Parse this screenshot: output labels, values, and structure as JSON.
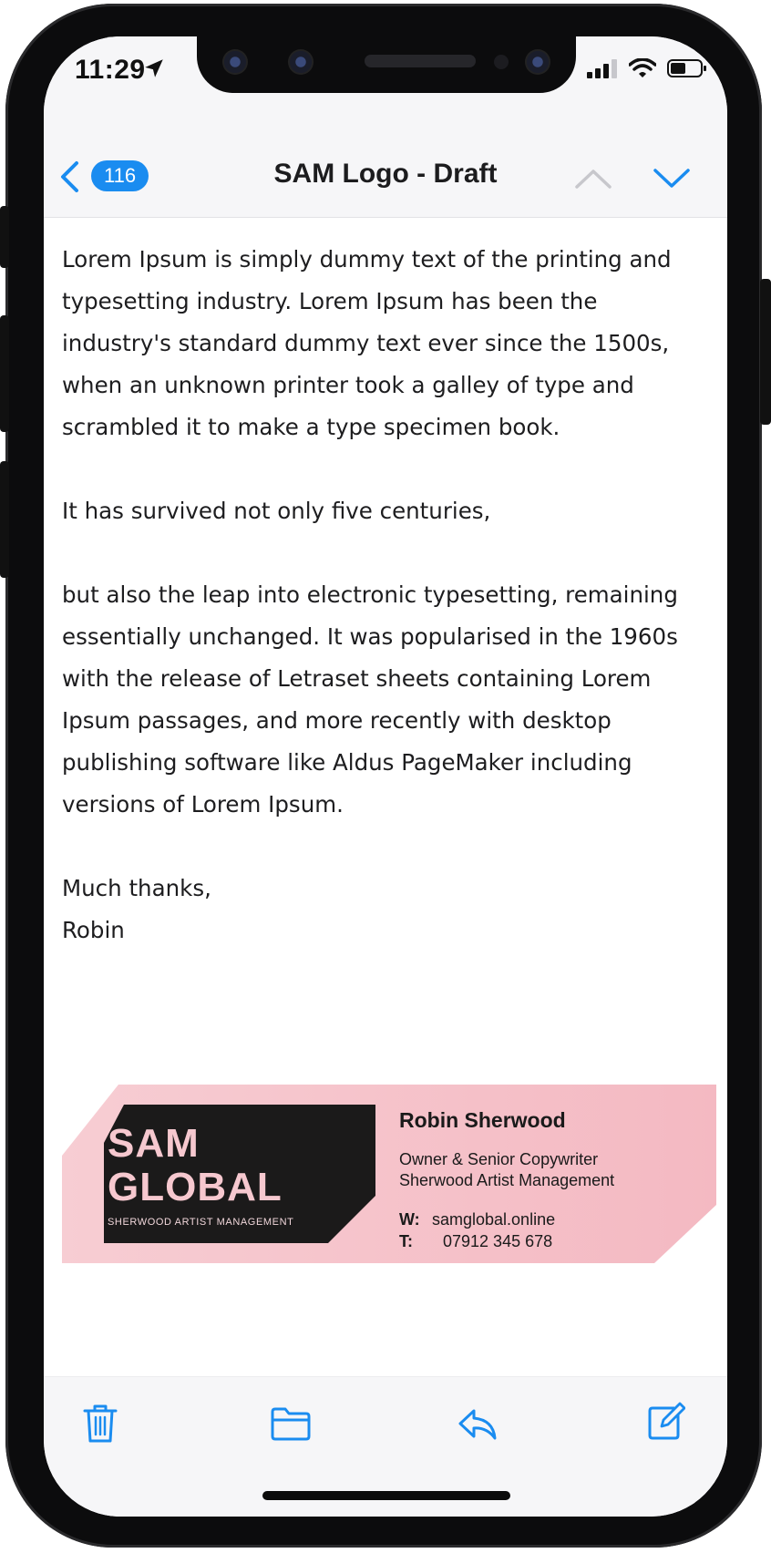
{
  "status": {
    "time": "11:29"
  },
  "nav": {
    "unread_count": "116",
    "title": "SAM Logo - Draft"
  },
  "email": {
    "paragraphs": [
      "Lorem Ipsum is simply dummy text of the printing and typesetting industry. Lorem Ipsum has been the industry's standard dummy text ever since the 1500s, when an unknown printer took a galley of type and scrambled it to make a type specimen book.",
      "It has survived not only five centuries,",
      "but also the leap into electronic typesetting, remaining essentially unchanged. It was popularised in the 1960s with the release of Letraset sheets containing Lorem Ipsum passages, and more recently with desktop publishing software like Aldus PageMaker including versions of Lorem Ipsum."
    ],
    "signoff": "Much thanks,",
    "sender": "Robin"
  },
  "signature": {
    "logo_line1": "SAM",
    "logo_line2": "GLOBAL",
    "logo_sub": "SHERWOOD ARTIST MANAGEMENT",
    "name": "Robin Sherwood",
    "role": "Owner & Senior Copywriter",
    "company": "Sherwood Artist Management",
    "web_label": "W:",
    "web": "samglobal.online",
    "phone_label": "T:",
    "phone": "07912 345 678"
  },
  "colors": {
    "accent": "#1a8cf0",
    "signature_pink": "#f6c2ca",
    "logo_dark": "#1b1a1a"
  },
  "icons": {
    "toolbar": [
      "trash-icon",
      "folder-icon",
      "reply-icon",
      "compose-icon"
    ]
  }
}
